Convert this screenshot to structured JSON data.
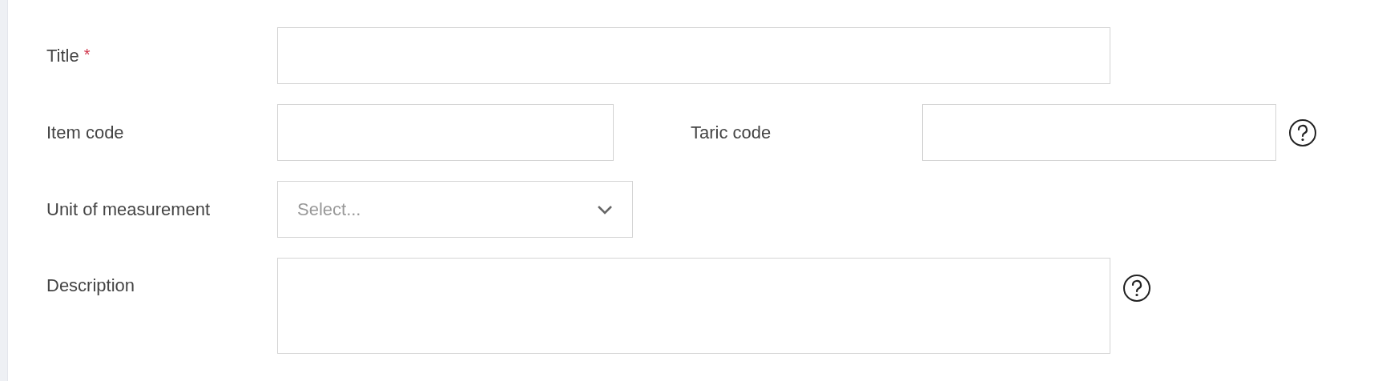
{
  "form": {
    "rows": [
      {
        "fields": [
          {
            "kind": "text",
            "label": "Title",
            "required": true,
            "help": false
          }
        ]
      },
      {
        "fields": [
          {
            "kind": "text",
            "label": "Item code",
            "required": false,
            "help": false
          },
          {
            "kind": "text",
            "label": "Taric code",
            "required": false,
            "help": true
          }
        ]
      },
      {
        "fields": [
          {
            "kind": "select",
            "label": "Unit of measurement",
            "required": false,
            "help": false,
            "placeholder": "Select..."
          }
        ]
      },
      {
        "fields": [
          {
            "kind": "textarea",
            "label": "Description",
            "required": false,
            "help": true
          }
        ]
      }
    ],
    "required_mark": "*"
  }
}
